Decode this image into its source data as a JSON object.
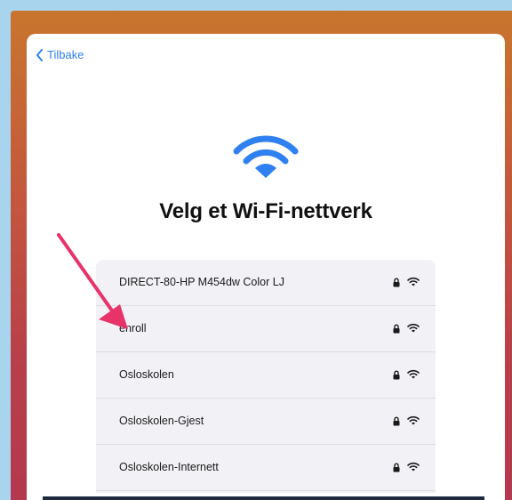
{
  "colors": {
    "accent": "#2f80f0",
    "arrow": "#e8336a",
    "sheet": "#ffffff",
    "list_background": "#f2f2f6"
  },
  "nav": {
    "back_label": "Tilbake",
    "back_icon": "chevron-left-icon"
  },
  "header": {
    "icon": "wifi-icon",
    "title": "Velg et Wi-Fi-nettverk"
  },
  "networks": [
    {
      "name": "DIRECT-80-HP M454dw Color LJ",
      "secured": true,
      "signal_icon": "wifi-icon"
    },
    {
      "name": "enroll",
      "secured": true,
      "signal_icon": "wifi-icon"
    },
    {
      "name": "Osloskolen",
      "secured": true,
      "signal_icon": "wifi-icon"
    },
    {
      "name": "Osloskolen-Gjest",
      "secured": true,
      "signal_icon": "wifi-icon"
    },
    {
      "name": "Osloskolen-Internett",
      "secured": true,
      "signal_icon": "wifi-icon"
    }
  ],
  "annotation": {
    "icon": "arrow-pointer-icon"
  }
}
